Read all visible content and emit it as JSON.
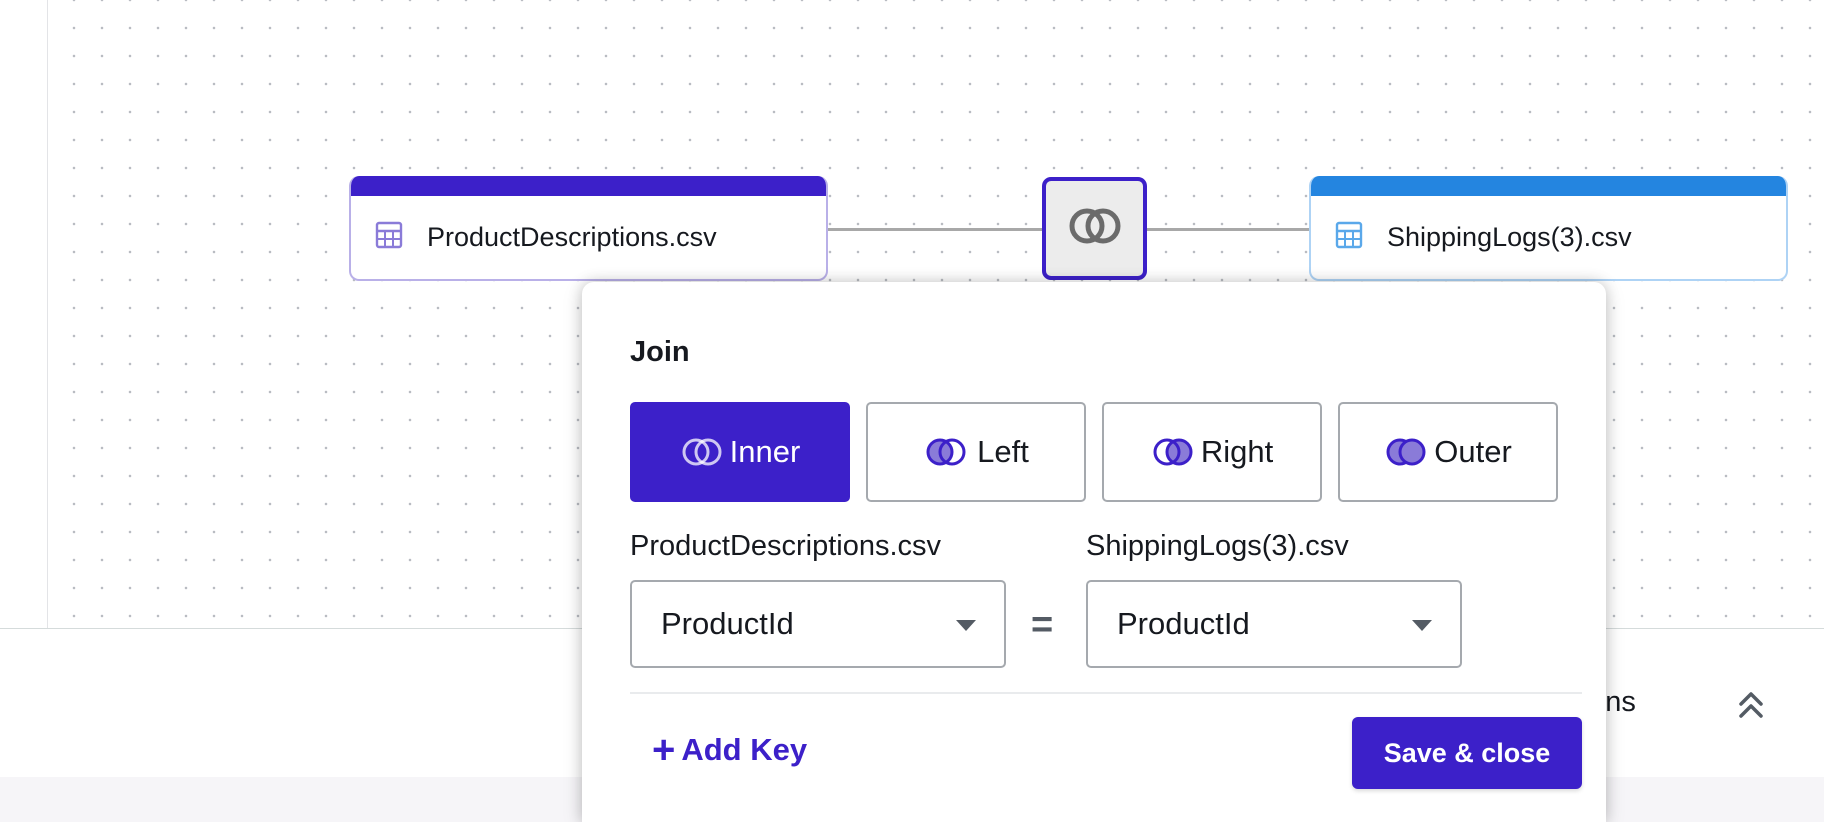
{
  "canvas": {
    "left_node": {
      "label": "ProductDescriptions.csv",
      "icon": "table-icon",
      "color": "#3c20c9"
    },
    "right_node": {
      "label": "ShippingLogs(3).csv",
      "icon": "table-icon",
      "color": "#2485e0"
    },
    "join_node": {
      "icon": "inner-join-icon"
    }
  },
  "join_panel": {
    "title": "Join",
    "join_types": [
      {
        "label": "Inner",
        "icon": "inner-join-icon",
        "selected": true
      },
      {
        "label": "Left",
        "icon": "left-join-icon",
        "selected": false
      },
      {
        "label": "Right",
        "icon": "right-join-icon",
        "selected": false
      },
      {
        "label": "Outer",
        "icon": "outer-join-icon",
        "selected": false
      }
    ],
    "left_source_label": "ProductDescriptions.csv",
    "right_source_label": "ShippingLogs(3).csv",
    "left_key_value": "ProductId",
    "right_key_value": "ProductId",
    "operator": "=",
    "add_key_label": "Add Key",
    "save_label": "Save & close",
    "accent_color": "#3c20c9"
  },
  "bottom_panel": {
    "partial_label": "umns",
    "toggle_icon": "double-chevron-up-icon"
  }
}
